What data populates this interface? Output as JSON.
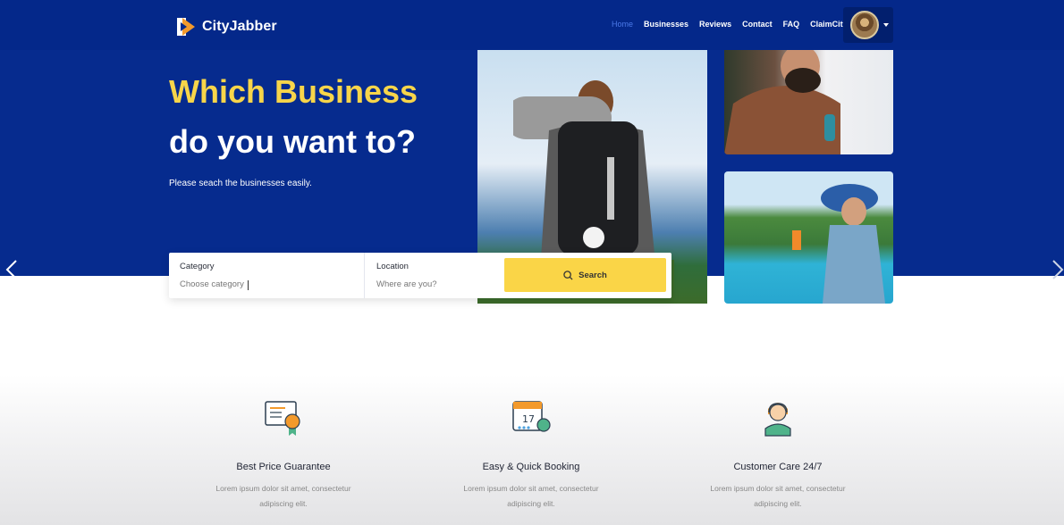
{
  "brand": {
    "name": "CityJabber"
  },
  "nav": {
    "items": [
      {
        "label": "Home",
        "active": true
      },
      {
        "label": "Businesses"
      },
      {
        "label": "Reviews"
      },
      {
        "label": "Contact"
      },
      {
        "label": "FAQ"
      },
      {
        "label": "ClaimCity"
      }
    ]
  },
  "hero": {
    "headline_1": "Which Business",
    "headline_2": "do you want to?",
    "subtitle": "Please seach the businesses easily."
  },
  "search": {
    "category_label": "Category",
    "category_placeholder": "Choose category",
    "location_label": "Location",
    "location_placeholder": "Where are you?",
    "button_label": "Search"
  },
  "features": [
    {
      "title": "Best Price Guarantee",
      "desc": "Lorem ipsum dolor sit amet, consectetur adipiscing elit.",
      "icon": "certificate-icon"
    },
    {
      "title": "Easy & Quick Booking",
      "desc": "Lorem ipsum dolor sit amet, consectetur adipiscing elit.",
      "icon": "calendar-icon"
    },
    {
      "title": "Customer Care 24/7",
      "desc": "Lorem ipsum dolor sit amet, consectetur adipiscing elit.",
      "icon": "support-agent-icon"
    }
  ],
  "colors": {
    "hero_bg": "#062b8e",
    "accent_yellow": "#fad547",
    "headline_yellow": "#f7d54a"
  }
}
